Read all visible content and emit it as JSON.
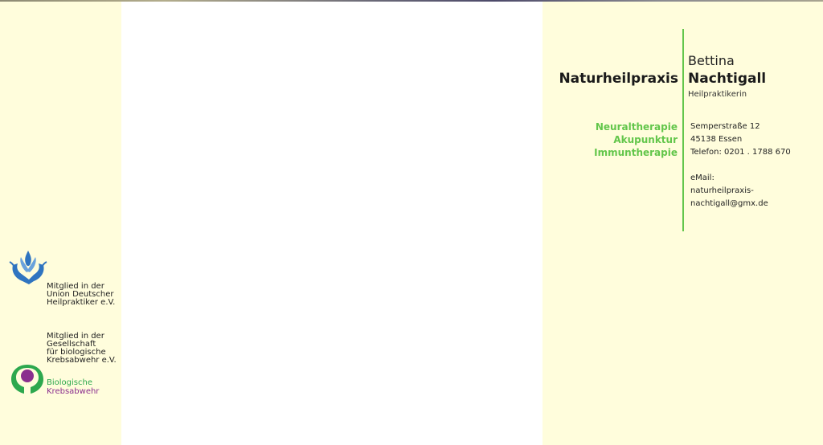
{
  "header": {
    "first_name": "Bettina",
    "praxis_label": "Naturheilpraxis",
    "last_name": "Nachtigall",
    "title": "Heilpraktikerin"
  },
  "services": [
    "Neuraltherapie",
    "Akupunktur",
    "Immuntherapie"
  ],
  "contact": {
    "street": "Semperstraße 12",
    "city": "45138 Essen",
    "phone": "Telefon: 0201 . 1788 670",
    "email_label": "eMail:",
    "email": "naturheilpraxis-nachtigall@gmx.de"
  },
  "memberships": {
    "udh": [
      "Mitglied in der",
      "Union Deutscher",
      "Heilpraktiker e.V."
    ],
    "gbk": [
      "Mitglied in der",
      "Gesellschaft",
      "für biologische",
      "Krebsabwehr e.V."
    ],
    "gbk_logo_text": [
      "Biologische",
      "Krebsabwehr"
    ]
  },
  "colors": {
    "accent_green": "#63c64b",
    "background": "#fffddc",
    "gbk_green": "#2da84e",
    "gbk_purple": "#8b2f8e",
    "udh_blue": "#2f74c0"
  }
}
